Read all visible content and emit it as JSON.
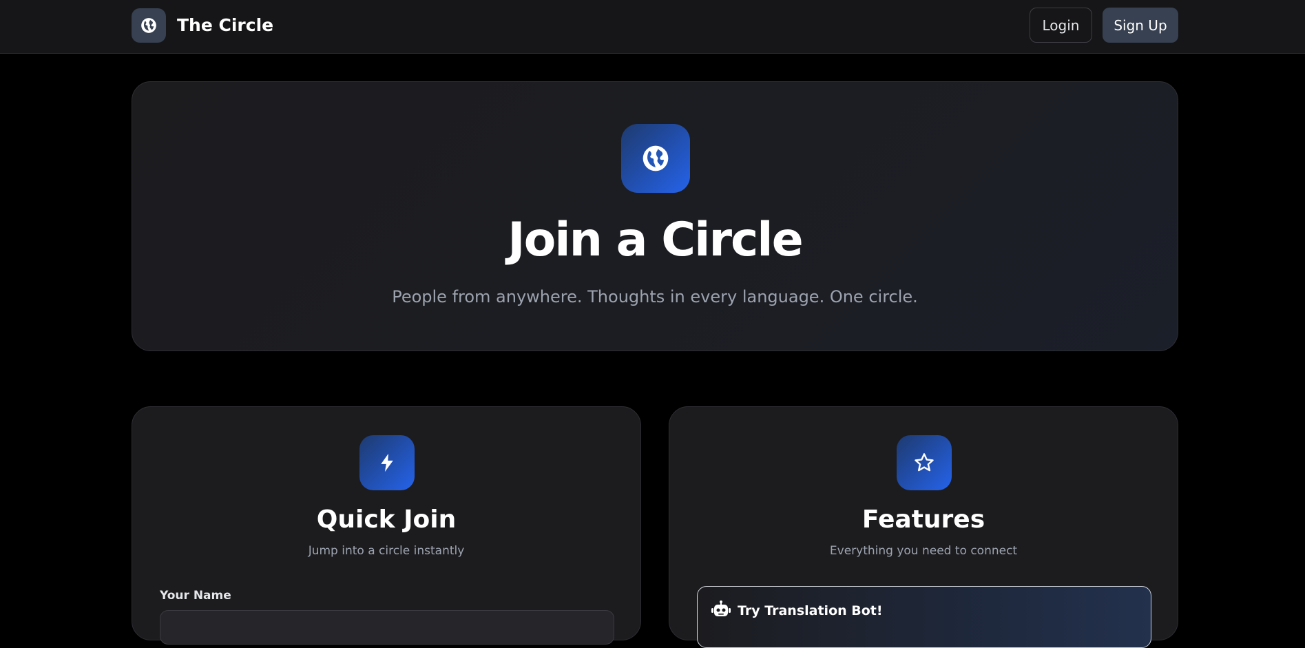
{
  "header": {
    "brand_name": "The Circle",
    "brand_icon": "globe-icon",
    "login_label": "Login",
    "signup_label": "Sign Up"
  },
  "hero": {
    "icon": "globe-icon",
    "title": "Join a Circle",
    "subtitle": "People from anywhere. Thoughts in every language. One circle."
  },
  "quick_join": {
    "icon": "lightning-icon",
    "title": "Quick Join",
    "subtitle": "Jump into a circle instantly",
    "name_label": "Your Name",
    "name_value": ""
  },
  "features": {
    "icon": "star-icon",
    "title": "Features",
    "subtitle": "Everything you need to connect",
    "items": [
      {
        "icon": "robot-icon",
        "label": "Try Translation Bot!"
      }
    ]
  },
  "colors": {
    "page_background": "#000000",
    "header_background": "#161618",
    "card_background": "#1c1c1f",
    "accent_blue": "#2563eb",
    "muted_text": "#9ca3af"
  }
}
